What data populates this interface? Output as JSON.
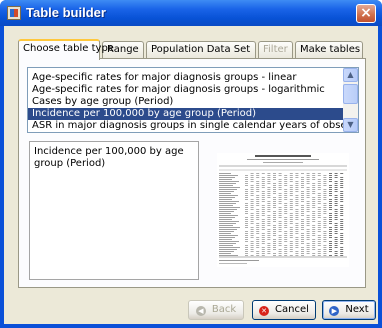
{
  "window": {
    "title": "Table builder",
    "close_label": "×"
  },
  "tabs": [
    {
      "label": "Choose table type",
      "active": true,
      "disabled": false
    },
    {
      "label": "Range",
      "active": false,
      "disabled": false
    },
    {
      "label": "Population Data Set",
      "active": false,
      "disabled": false
    },
    {
      "label": "Filter",
      "active": false,
      "disabled": true
    },
    {
      "label": "Make tables",
      "active": false,
      "disabled": false
    }
  ],
  "table_types": [
    {
      "label": "Age-specific rates for major diagnosis groups - linear",
      "selected": false
    },
    {
      "label": "Age-specific rates for major diagnosis groups - logarithmic",
      "selected": false
    },
    {
      "label": "Cases by age group (Period)",
      "selected": false
    },
    {
      "label": "Incidence per 100,000 by age group (Period)",
      "selected": true
    },
    {
      "label": "ASR in major diagnosis groups in single calendar years of observation",
      "selected": false
    }
  ],
  "scrollbar": {
    "up_glyph": "▲",
    "down_glyph": "▼"
  },
  "description": "Incidence per 100,000 by age group (Period)",
  "preview": {
    "icon": "table-preview-thumbnail"
  },
  "buttons": {
    "back": "Back",
    "cancel": "Cancel",
    "next": "Next"
  },
  "colors": {
    "selection": "#2c4b8c",
    "titlebar": "#0a50d8",
    "active_tab_accent": "#ffc83c"
  }
}
